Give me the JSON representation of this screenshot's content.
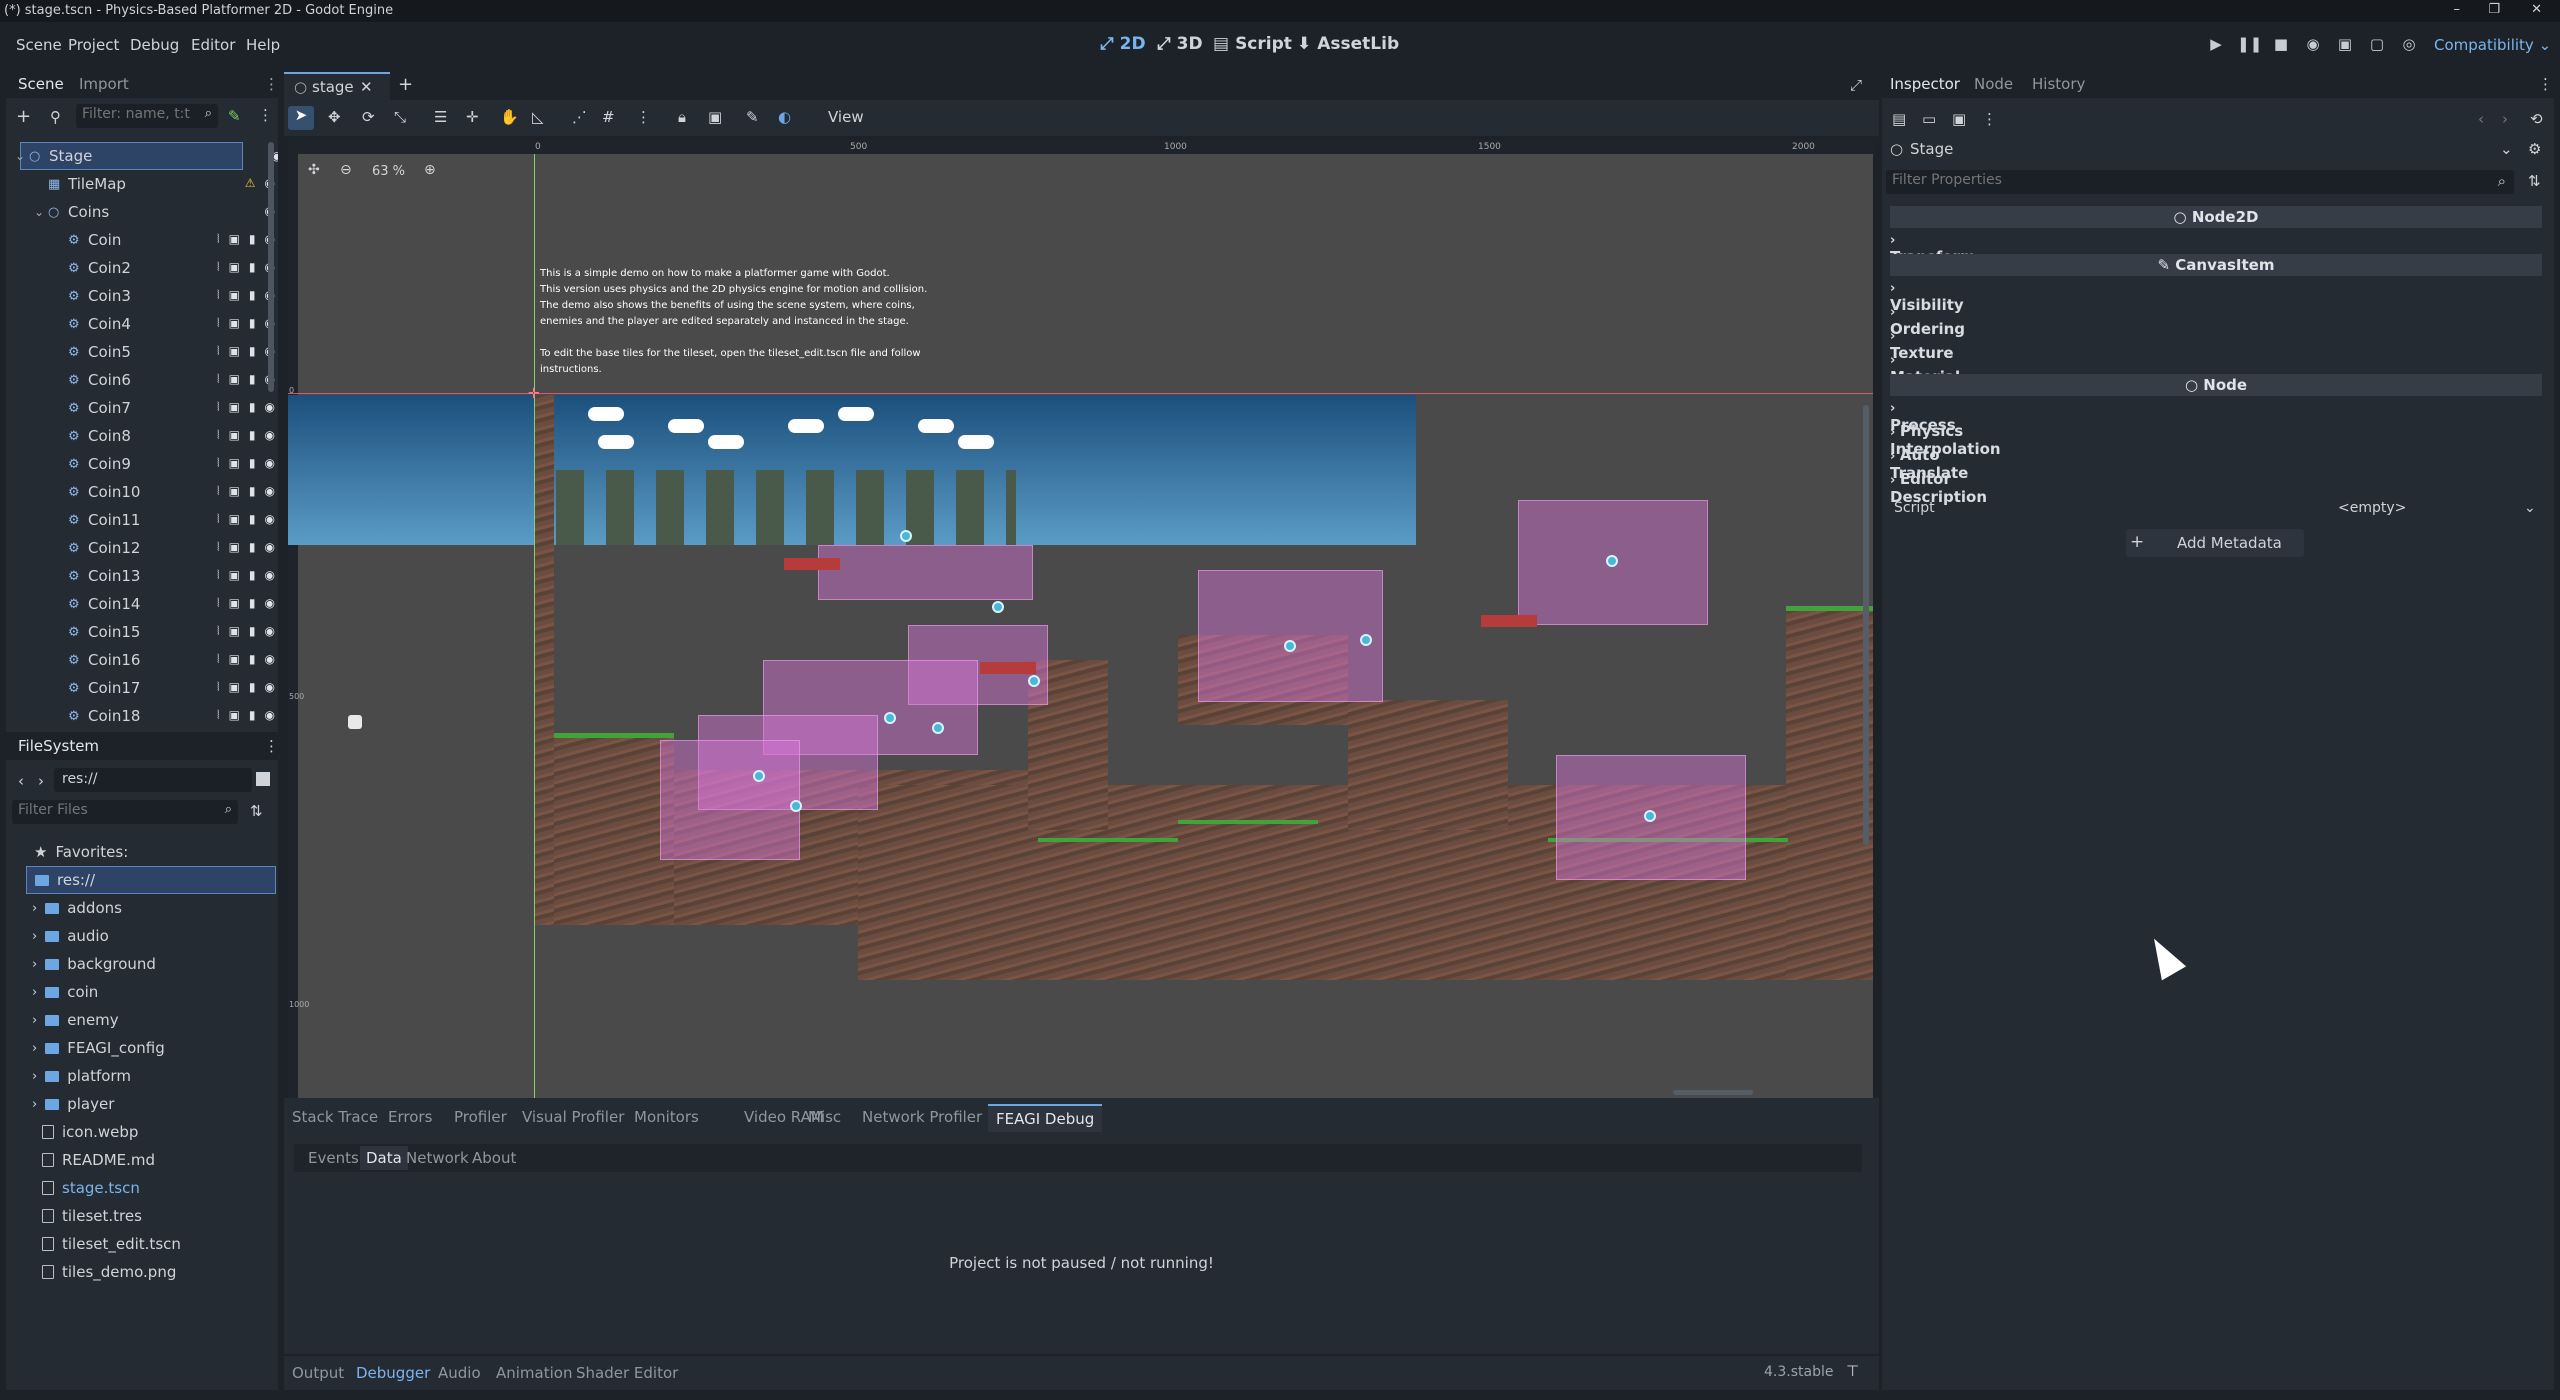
{
  "window_title": "(*) stage.tscn - Physics-Based Platformer 2D - Godot Engine",
  "menus": [
    "Scene",
    "Project",
    "Debug",
    "Editor",
    "Help"
  ],
  "modes": [
    {
      "label": "2D",
      "icon": "2d-icon"
    },
    {
      "label": "3D",
      "icon": "3d-icon"
    },
    {
      "label": "Script",
      "icon": "script-icon"
    },
    {
      "label": "AssetLib",
      "icon": "assetlib-icon"
    }
  ],
  "renderer": "Compatibility",
  "scene_dock": {
    "tabs": [
      "Scene",
      "Import"
    ],
    "filter_placeholder": "Filter: name, t:t",
    "tree": [
      {
        "label": "Stage",
        "depth": 0,
        "selected": true
      },
      {
        "label": "TileMap",
        "depth": 1,
        "warning": true
      },
      {
        "label": "Coins",
        "depth": 1
      },
      {
        "label": "Coin",
        "depth": 2
      },
      {
        "label": "Coin2",
        "depth": 2
      },
      {
        "label": "Coin3",
        "depth": 2
      },
      {
        "label": "Coin4",
        "depth": 2
      },
      {
        "label": "Coin5",
        "depth": 2
      },
      {
        "label": "Coin6",
        "depth": 2
      },
      {
        "label": "Coin7",
        "depth": 2
      },
      {
        "label": "Coin8",
        "depth": 2
      },
      {
        "label": "Coin9",
        "depth": 2
      },
      {
        "label": "Coin10",
        "depth": 2
      },
      {
        "label": "Coin11",
        "depth": 2
      },
      {
        "label": "Coin12",
        "depth": 2
      },
      {
        "label": "Coin13",
        "depth": 2
      },
      {
        "label": "Coin14",
        "depth": 2
      },
      {
        "label": "Coin15",
        "depth": 2
      },
      {
        "label": "Coin16",
        "depth": 2
      },
      {
        "label": "Coin17",
        "depth": 2
      },
      {
        "label": "Coin18",
        "depth": 2
      }
    ]
  },
  "filesystem": {
    "title": "FileSystem",
    "path": "res://",
    "filter_placeholder": "Filter Files",
    "favorites_label": "Favorites:",
    "root_label": "res://",
    "items": [
      {
        "label": "addons",
        "type": "folder"
      },
      {
        "label": "audio",
        "type": "folder"
      },
      {
        "label": "background",
        "type": "folder"
      },
      {
        "label": "coin",
        "type": "folder"
      },
      {
        "label": "enemy",
        "type": "folder"
      },
      {
        "label": "FEAGI_config",
        "type": "folder"
      },
      {
        "label": "platform",
        "type": "folder"
      },
      {
        "label": "player",
        "type": "folder"
      },
      {
        "label": "icon.webp",
        "type": "file"
      },
      {
        "label": "README.md",
        "type": "file"
      },
      {
        "label": "stage.tscn",
        "type": "file",
        "active": true
      },
      {
        "label": "tileset.tres",
        "type": "file"
      },
      {
        "label": "tileset_edit.tscn",
        "type": "file"
      },
      {
        "label": "tiles_demo.png",
        "type": "file"
      }
    ]
  },
  "editor_tab": "stage",
  "toolbar": {
    "view_label": "View"
  },
  "zoom": "63 %",
  "ruler_labels": [
    "0",
    "500",
    "1000",
    "1500",
    "2000"
  ],
  "ruler_v_labels": [
    "0",
    "500",
    "1000"
  ],
  "demo_text": [
    "This is a simple demo on how to make a platformer game with Godot.",
    "This version uses physics and the 2D physics engine for motion and collision.",
    "The demo also shows the benefits of using the scene system, where coins,",
    "enemies and the player are edited separately and instanced in the stage.",
    "",
    "To edit the base tiles for the  tileset, open the tileset_edit.tscn file and follow",
    "instructions."
  ],
  "debugger": {
    "tabs": [
      "Stack Trace",
      "Errors",
      "Profiler",
      "Visual Profiler",
      "Monitors",
      "Video RAM",
      "Misc",
      "Network Profiler",
      "FEAGI Debug"
    ],
    "active_tab": "FEAGI Debug",
    "sub_tabs": [
      "Events",
      "Data",
      "Network",
      "About"
    ],
    "active_sub_tab": "Data",
    "message": "Project is not paused / not running!"
  },
  "bottom_tabs": [
    "Output",
    "Debugger",
    "Audio",
    "Animation",
    "Shader Editor"
  ],
  "active_bottom_tab": "Debugger",
  "version": "4.3.stable",
  "inspector": {
    "tabs": [
      "Inspector",
      "Node",
      "History"
    ],
    "node_name": "Stage",
    "filter_placeholder": "Filter Properties",
    "sections": [
      {
        "header": "Node2D",
        "items": [
          "Transform"
        ]
      },
      {
        "header": "CanvasItem",
        "items": [
          "Visibility",
          "Ordering",
          "Texture",
          "Material"
        ]
      },
      {
        "header": "Node",
        "items": [
          "Process",
          "Physics Interpolation",
          "Auto Translate",
          "Editor Description"
        ]
      }
    ],
    "script_label": "Script",
    "script_value": "<empty>",
    "add_metadata": "Add Metadata"
  },
  "colors": {
    "accent": "#6ca7e4",
    "bg": "#1d2229",
    "panel": "#252b33",
    "warning": "#f2c33c",
    "pink": "#d67bd6"
  }
}
